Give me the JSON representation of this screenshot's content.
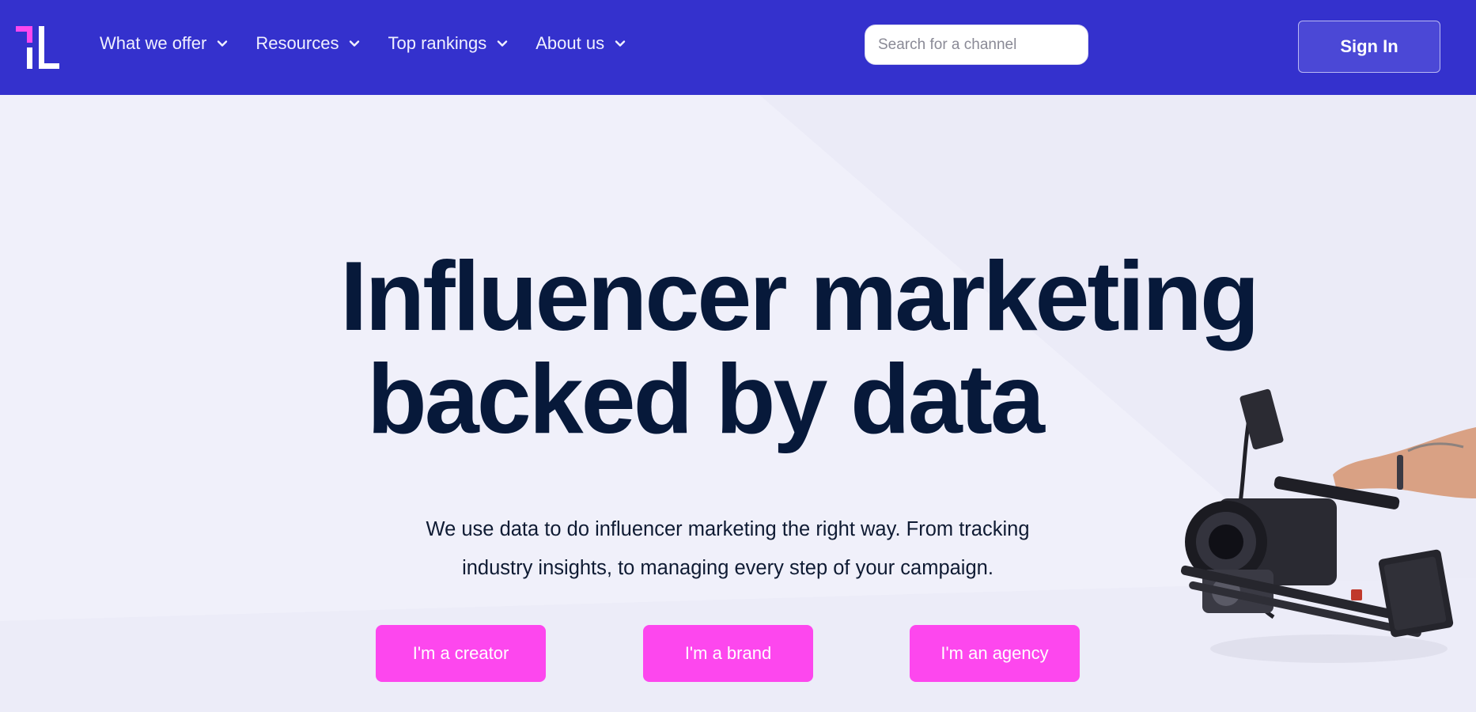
{
  "colors": {
    "header_bg": "#3431cd",
    "page_bg": "#f0f0fa",
    "accent_pink": "#fd47ee",
    "headline": "#07193a"
  },
  "header": {
    "logo_icon": "influencer-logo-icon",
    "nav": [
      {
        "label": "What we offer",
        "icon": "chevron-down-icon"
      },
      {
        "label": "Resources",
        "icon": "chevron-down-icon"
      },
      {
        "label": "Top rankings",
        "icon": "chevron-down-icon"
      },
      {
        "label": "About us",
        "icon": "chevron-down-icon"
      }
    ],
    "search": {
      "placeholder": "Search for a channel",
      "value": ""
    },
    "signin_label": "Sign In"
  },
  "hero": {
    "headline_line1": "Influencer marketing",
    "headline_line2": "backed by data",
    "subtitle_line1": "We use data to do influencer marketing the right way. From tracking",
    "subtitle_line2": "industry insights, to managing every step of your campaign.",
    "buttons": [
      {
        "label": "I'm a creator"
      },
      {
        "label": "I'm a brand"
      },
      {
        "label": "I'm an agency"
      }
    ],
    "image": "camera-rig-photo"
  }
}
